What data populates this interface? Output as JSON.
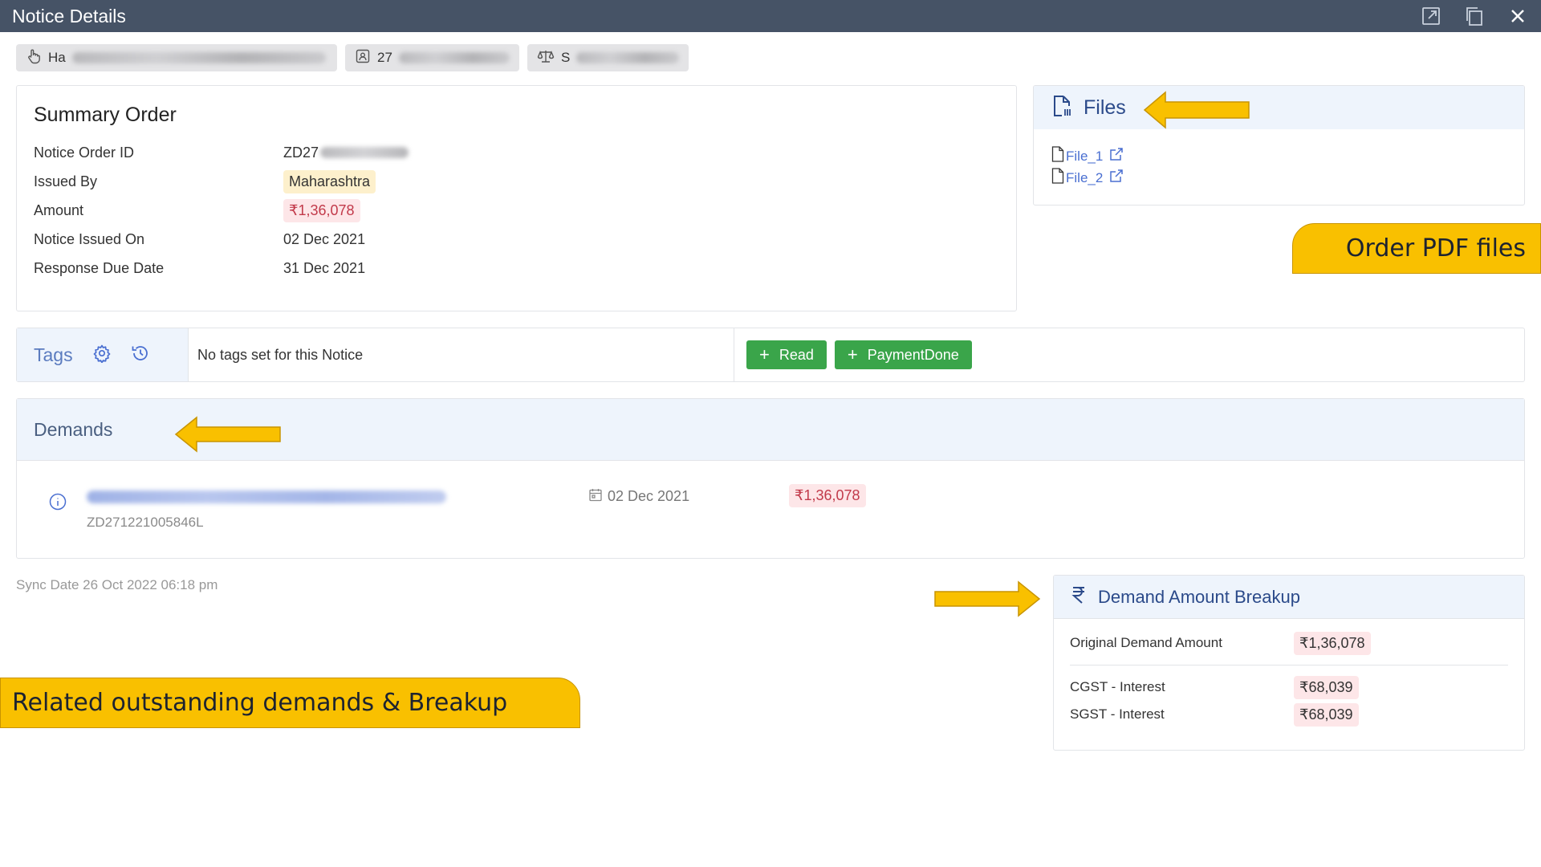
{
  "window": {
    "title": "Notice Details",
    "actions": [
      "open-external-icon",
      "copy-icon",
      "close-icon"
    ]
  },
  "chips": [
    {
      "icon": "hand-pointer-icon",
      "prefix": "Ha"
    },
    {
      "icon": "id-card-icon",
      "prefix": "27"
    },
    {
      "icon": "scales-icon",
      "prefix": "S"
    }
  ],
  "summary": {
    "title": "Summary Order",
    "rows": [
      {
        "label": "Notice Order ID",
        "value": "ZD27"
      },
      {
        "label": "Issued By",
        "value": "Maharashtra"
      },
      {
        "label": "Amount",
        "value": "₹1,36,078"
      },
      {
        "label": "Notice Issued On",
        "value": "02 Dec 2021"
      },
      {
        "label": "Response Due Date",
        "value": "31 Dec 2021"
      }
    ]
  },
  "files": {
    "title": "Files",
    "items": [
      {
        "label": "File_1"
      },
      {
        "label": "File_2"
      }
    ]
  },
  "callouts": {
    "order_pdf": "Order PDF files",
    "related": "Related outstanding demands & Breakup"
  },
  "tags": {
    "label": "Tags",
    "empty_text": "No tags set for this Notice",
    "buttons": [
      {
        "label": "Read"
      },
      {
        "label": "PaymentDone"
      }
    ]
  },
  "demands": {
    "title": "Demands",
    "row": {
      "order_id": "ZD271221005846L",
      "date": "02 Dec 2021",
      "amount": "₹1,36,078"
    }
  },
  "sync": {
    "text": "Sync Date 26 Oct 2022 06:18 pm"
  },
  "breakup": {
    "title": "Demand Amount Breakup",
    "original": {
      "label": "Original Demand Amount",
      "value": "₹1,36,078"
    },
    "rows": [
      {
        "label": "CGST - Interest",
        "value": "₹68,039"
      },
      {
        "label": "SGST - Interest",
        "value": "₹68,039"
      }
    ]
  },
  "colors": {
    "titlebar": "#465366",
    "accent_blue": "#2b4a8a",
    "green": "#3aa54a",
    "callout_yellow": "#f9c000",
    "amount_red": "#c23a4a"
  }
}
